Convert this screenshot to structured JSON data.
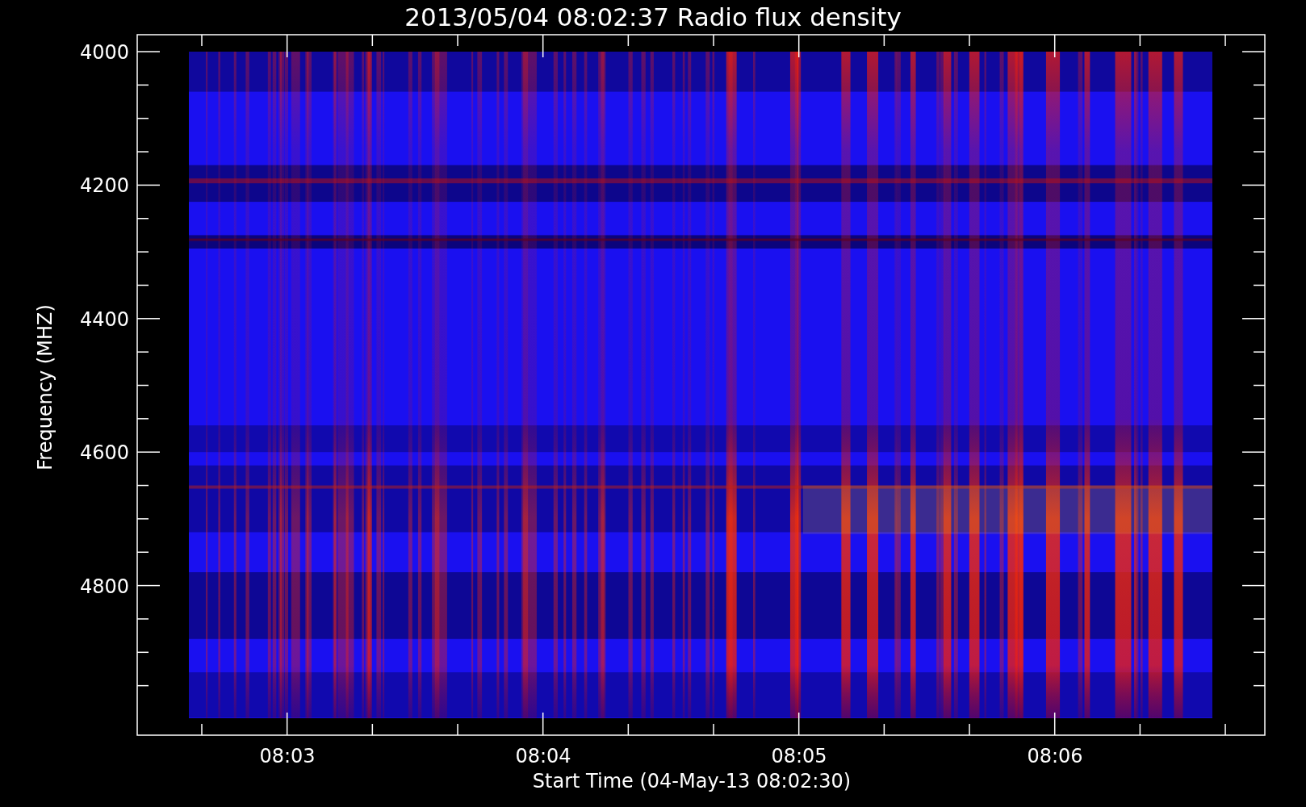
{
  "title": "2013/05/04 08:02:37 Radio flux density",
  "y_axis": {
    "label": "Frequency (MHZ)",
    "ticks": [
      "4000",
      "4200",
      "4400",
      "4600",
      "4800"
    ]
  },
  "x_axis": {
    "label": "Start Time (04-May-13 08:02:30)",
    "ticks": [
      "08:03",
      "08:04",
      "08:05",
      "08:06"
    ]
  }
}
